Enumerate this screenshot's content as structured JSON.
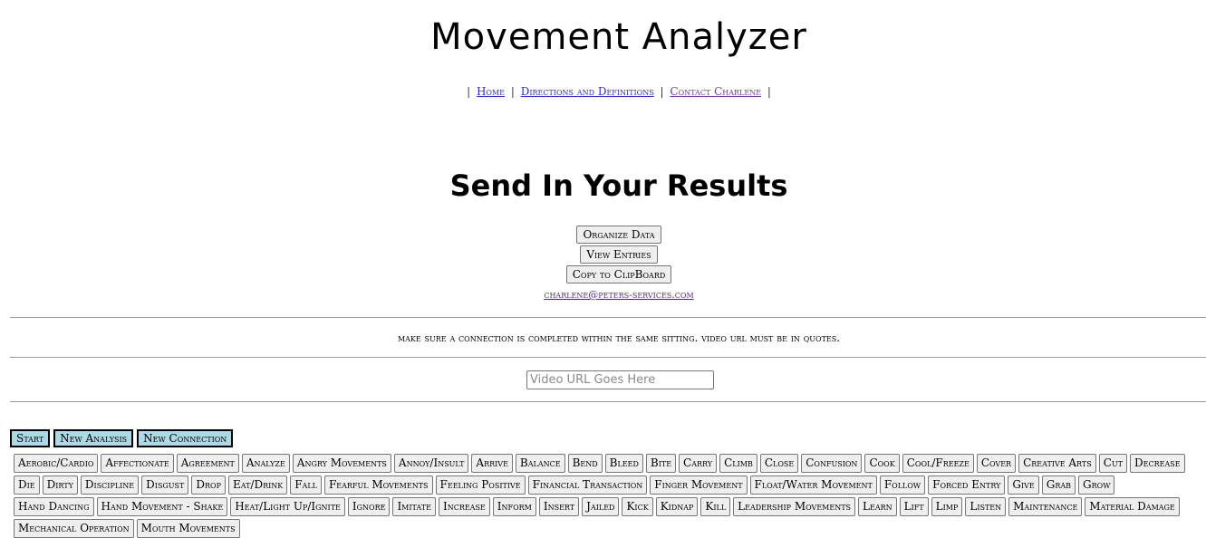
{
  "header": {
    "title": "Movement Analyzer",
    "nav": [
      {
        "label": "Home"
      },
      {
        "label": "Directions and Definitions"
      },
      {
        "label": "Contact Charlene"
      }
    ],
    "separator": "|"
  },
  "main": {
    "subtitle": "Send In Your Results",
    "buttons": {
      "organize": "Organize Data",
      "view": "View Entries",
      "copy": "Copy to ClipBoard"
    },
    "email": "charlene@peters-services.com",
    "notice": "make sure a connection is completed within the same sitting. video url must be in quotes.",
    "video_url": {
      "value": "",
      "placeholder": "Video URL Goes Here"
    },
    "controls": [
      "Start",
      "New Analysis",
      "New Connection"
    ],
    "tags": [
      "Aerobic/Cardio",
      "Affectionate",
      "Agreement",
      "Analyze",
      "Angry Movements",
      "Annoy/Insult",
      "Arrive",
      "Balance",
      "Bend",
      "Bleed",
      "Bite",
      "Carry",
      "Climb",
      "Close",
      "Confusion",
      "Cook",
      "Cool/Freeze",
      "Cover",
      "Creative Arts",
      "Cut",
      "Decrease",
      "Die",
      "Dirty",
      "Discipline",
      "Disgust",
      "Drop",
      "Eat/Drink",
      "Fall",
      "Fearful Movements",
      "Feeling Positive",
      "Financial Transaction",
      "Finger Movement",
      "Float/Water Movement",
      "Follow",
      "Forced Entry",
      "Give",
      "Grab",
      "Grow",
      "Hand Dancing",
      "Hand Movement - Shake",
      "Heat/Light Up/Ignite",
      "Ignore",
      "Imitate",
      "Increase",
      "Inform",
      "Insert",
      "Jailed",
      "Kick",
      "Kidnap",
      "Kill",
      "Leadership Movements",
      "Learn",
      "Lift",
      "Limp",
      "Listen",
      "Maintenance",
      "Material Damage",
      "Mechanical Operation",
      "Mouth Movements"
    ]
  }
}
